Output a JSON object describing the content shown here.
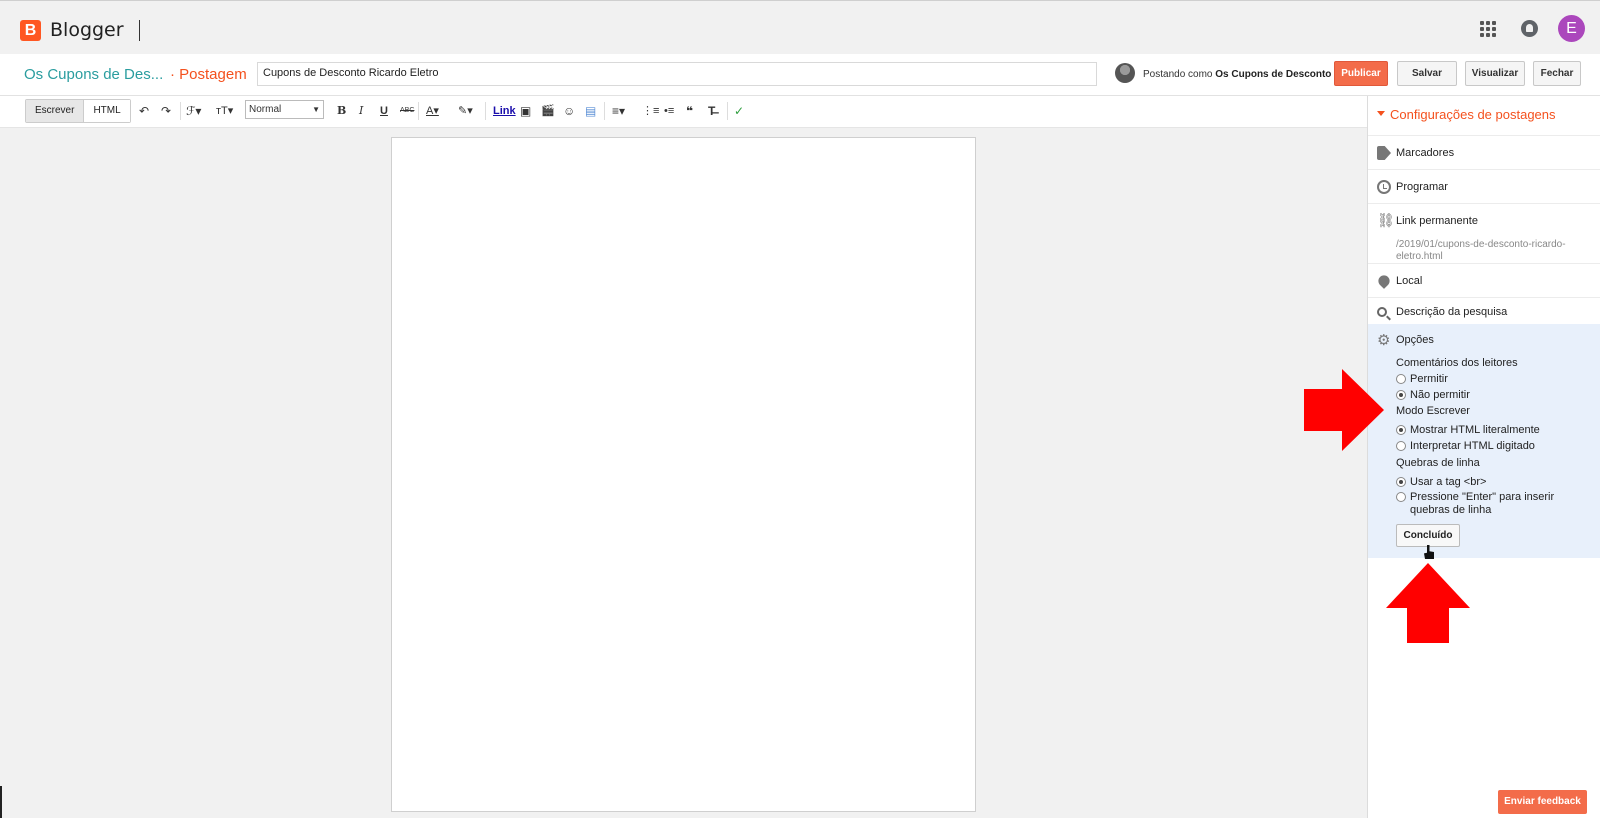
{
  "app": {
    "name": "Blogger",
    "avatar_letter": "E"
  },
  "post_header": {
    "blog_name": "Os Cupons de Des...",
    "crumb": "· Postagem",
    "title_value": "Cupons de Desconto Ricardo Eletro",
    "posting_as_label": "Postando como",
    "posting_as_name": "Os Cupons de Desconto",
    "buttons": {
      "publish": "Publicar",
      "save": "Salvar",
      "preview": "Visualizar",
      "close": "Fechar"
    }
  },
  "toolbar": {
    "tabs": [
      "Escrever",
      "HTML"
    ],
    "font_size": "Normal",
    "link_label": "Link",
    "glyphs": {
      "undo": "↶",
      "redo": "↷",
      "font": "ℱ▾",
      "size": "тT▾",
      "bold": "B",
      "italic": "I",
      "underline": "U",
      "strike": "ABC",
      "text_color": "A▾",
      "highlight": "✎▾",
      "image": "▣",
      "video": "🎬",
      "emoji": "☺",
      "jump_break": "▤",
      "align": "≡▾",
      "numbered_list": "⋮≡",
      "bullet_list": "•≡",
      "quote": "❝",
      "clear_format": "T̶",
      "spellcheck": "✓"
    }
  },
  "sidebar": {
    "header": "Configurações de postagens",
    "items": {
      "labels": "Marcadores",
      "schedule": "Programar",
      "permalink": "Link permanente",
      "permalink_value": "/2019/01/cupons-de-desconto-ricardo-eletro.html",
      "location": "Local",
      "search_description": "Descrição da pesquisa"
    },
    "options": {
      "title": "Opções",
      "reader_comments": "Comentários dos leitores",
      "allow": "Permitir",
      "disallow": "Não permitir",
      "compose_mode": "Modo Escrever",
      "show_html": "Mostrar HTML literalmente",
      "interpret_html": "Interpretar HTML digitado",
      "line_breaks": "Quebras de linha",
      "use_br": "Usar a tag <br>",
      "press_enter": "Pressione \"Enter\" para inserir quebras de linha",
      "done": "Concluído",
      "selected": {
        "comments": "disallow",
        "compose": "show_html",
        "line_breaks": "use_br"
      }
    }
  },
  "feedback": "Enviar feedback",
  "colors": {
    "brand": "#ff5722",
    "accent_orange": "#f36c4a",
    "teal": "#2a9d9f",
    "annotation_arrow": "#ff0000",
    "options_bg": "#e8f0fb"
  }
}
